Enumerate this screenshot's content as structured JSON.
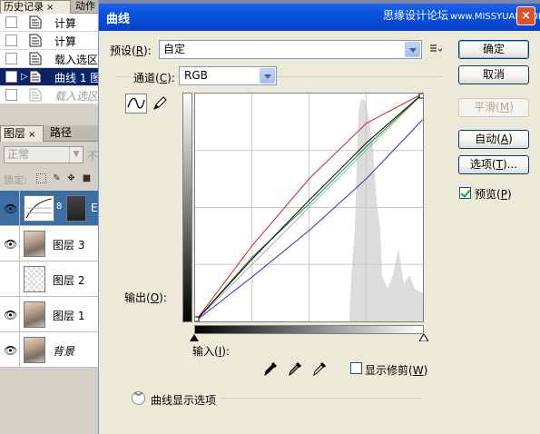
{
  "history_panel": {
    "tabs": [
      {
        "label": "历史记录",
        "close": "×"
      },
      {
        "label": "动作"
      }
    ],
    "items": [
      {
        "label": "计算",
        "state": "normal"
      },
      {
        "label": "计算",
        "state": "normal"
      },
      {
        "label": "载入选区",
        "state": "normal"
      },
      {
        "label": "曲线 1 图",
        "state": "selected"
      },
      {
        "label": "载入选区",
        "state": "ghost"
      }
    ]
  },
  "layers_panel": {
    "tabs": [
      {
        "label": "图层",
        "close": "×"
      },
      {
        "label": "路径"
      }
    ],
    "blend_mode": "正常",
    "blend_extra": "不",
    "lock_label": "锁定:",
    "layers": [
      {
        "name": "E",
        "type": "curves-adjustment",
        "selected": true
      },
      {
        "name": "图层 3",
        "type": "photo"
      },
      {
        "name": "图层 2",
        "type": "transparent"
      },
      {
        "name": "图层 1",
        "type": "photo"
      },
      {
        "name": "背景",
        "type": "photo",
        "italic": true
      }
    ]
  },
  "dialog": {
    "title": "曲线",
    "watermark": "思缘设计论坛",
    "watermark_url": "www.MISSYUAN.COM",
    "close": "×",
    "preset": {
      "label": "预设",
      "key": "R",
      "value": "自定"
    },
    "channel": {
      "label": "通道",
      "key": "C",
      "value": "RGB"
    },
    "output": {
      "label": "输出",
      "key": "O"
    },
    "input": {
      "label": "输入",
      "key": "I"
    },
    "show_clipping": {
      "label": "显示修剪",
      "key": "W",
      "checked": false
    },
    "curve_display_options": "曲线显示选项",
    "buttons": {
      "ok": "确定",
      "cancel": "取消",
      "smooth": "平滑",
      "smooth_key": "M",
      "auto": "自动",
      "auto_key": "A",
      "options": "选项",
      "options_key": "T",
      "options_suffix": "..."
    },
    "preview": {
      "label": "预览",
      "key": "P",
      "checked": true
    }
  },
  "curves": {
    "input_range": [
      0,
      255
    ],
    "output_range": [
      0,
      255
    ],
    "grid_divisions": 4,
    "rgb_curve": [
      [
        0,
        0
      ],
      [
        64,
        70
      ],
      [
        128,
        136
      ],
      [
        192,
        200
      ],
      [
        255,
        255
      ]
    ],
    "red_curve": [
      [
        0,
        0
      ],
      [
        64,
        85
      ],
      [
        128,
        160
      ],
      [
        192,
        222
      ],
      [
        255,
        255
      ]
    ],
    "green_curve": [
      [
        0,
        0
      ],
      [
        64,
        72
      ],
      [
        128,
        132
      ],
      [
        192,
        196
      ],
      [
        255,
        255
      ]
    ],
    "blue_curve": [
      [
        0,
        0
      ],
      [
        64,
        50
      ],
      [
        128,
        102
      ],
      [
        192,
        160
      ],
      [
        255,
        226
      ]
    ],
    "colors": {
      "rgb": "#000000",
      "red": "#d42020",
      "green": "#1a8a1a",
      "blue": "#3030d0",
      "grid": "#c8c8c8",
      "histogram": "#dcdcdc"
    }
  }
}
